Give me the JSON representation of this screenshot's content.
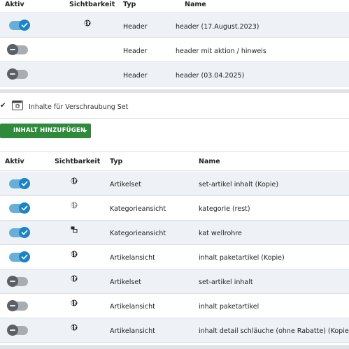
{
  "table1": {
    "columns": {
      "active": "Aktiv",
      "visibility": "Sichtbarkeit",
      "type": "Typ",
      "name": "Name"
    },
    "rows": [
      {
        "active": true,
        "visibility": "globe-icon",
        "type": "Header",
        "name": "header (17.August.2023)"
      },
      {
        "active": false,
        "visibility": "",
        "type": "Header",
        "name": "header mit aktion / hinweis"
      },
      {
        "active": false,
        "visibility": "",
        "type": "Header",
        "name": "header (03.04.2025)"
      }
    ]
  },
  "set": {
    "title": "Inhalte für Verschraubung Set",
    "add_button": "INHALT HINZUFÜGEN"
  },
  "table2": {
    "columns": {
      "active": "Aktiv",
      "visibility": "Sichtbarkeit",
      "type": "Typ",
      "name": "Name"
    },
    "rows": [
      {
        "active": true,
        "visibility": "globe-icon",
        "type": "Artikelset",
        "name": "set-artikel inhalt (Kopie)"
      },
      {
        "active": true,
        "visibility": "globe-icon-gray",
        "type": "Kategorieansicht",
        "name": "kategorie (rest)"
      },
      {
        "active": true,
        "visibility": "layers-icon",
        "type": "Kategorieansicht",
        "name": "kat wellrohre"
      },
      {
        "active": true,
        "visibility": "globe-icon",
        "type": "Artikelansicht",
        "name": "inhalt paketartikel (Kopie)"
      },
      {
        "active": false,
        "visibility": "globe-icon",
        "type": "Artikelset",
        "name": "set-artikel inhalt"
      },
      {
        "active": false,
        "visibility": "globe-icon",
        "type": "Artikelansicht",
        "name": "inhalt paketartikel"
      },
      {
        "active": false,
        "visibility": "globe-icon",
        "type": "Artikelansicht",
        "name": "inhalt detail schläuche (ohne Rabatte) (Kopie)"
      }
    ]
  },
  "colors": {
    "toggle_on": "#1a84c7",
    "toggle_off": "#5b6066",
    "add_button": "#2f8a3c",
    "row_alt": "#eef1f5"
  }
}
